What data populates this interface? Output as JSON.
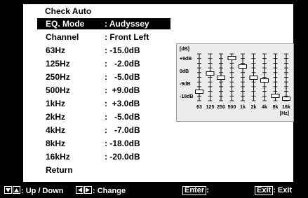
{
  "menu": {
    "title": "Check Auto",
    "rows": [
      {
        "label": "EQ. Mode",
        "value": ": Audyssey",
        "selected": true
      },
      {
        "label": "Channel",
        "value": ": Front Left"
      },
      {
        "label": "63Hz",
        "value": ": -15.0dB"
      },
      {
        "label": "125Hz",
        "value": ":   -2.0dB"
      },
      {
        "label": "250Hz",
        "value": ":   -5.0dB"
      },
      {
        "label": "500Hz",
        "value": ":  +9.0dB"
      },
      {
        "label": "1kHz",
        "value": ":  +3.0dB"
      },
      {
        "label": "2kHz",
        "value": ":   -5.0dB"
      },
      {
        "label": "4kHz",
        "value": ":   -7.0dB"
      },
      {
        "label": "8kHz",
        "value": ": -18.0dB"
      },
      {
        "label": "16kHz",
        "value": ": -20.0dB"
      },
      {
        "label": "Return",
        "value": ""
      }
    ]
  },
  "graph": {
    "y_unit": "[dB]",
    "x_unit": "[Hz]",
    "y_ticks": [
      "+9dB",
      "0dB",
      "-9dB",
      "-18dB"
    ],
    "bands": [
      "63",
      "125",
      "250",
      "500",
      "1k",
      "2k",
      "4k",
      "8k",
      "16k"
    ],
    "values": [
      -15,
      -2,
      -5,
      9,
      3,
      -5,
      -7,
      -18,
      -20
    ],
    "ylim": [
      -20,
      10
    ]
  },
  "footer": {
    "updown": ": Up / Down",
    "change": ": Change",
    "enter_key": "Enter",
    "enter_text": ":",
    "exit_key": "Exit",
    "exit_text": ": Exit"
  }
}
